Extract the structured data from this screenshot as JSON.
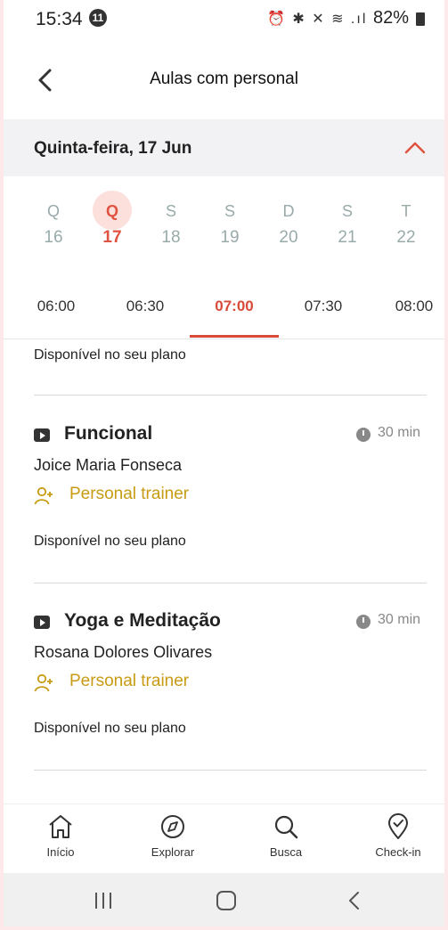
{
  "status_bar": {
    "time": "15:34",
    "notification_count": "11",
    "icons": "⏰ ✱ ✕ ≋ .ıl",
    "battery": "82%"
  },
  "header": {
    "title": "Aulas com personal",
    "back_icon": "chevron-left-icon"
  },
  "date_bar": {
    "label": "Quinta-feira, 17 Jun",
    "toggle_icon": "chevron-up-icon",
    "accent_color": "#e05340"
  },
  "week": [
    {
      "weekday": "Q",
      "day": "16"
    },
    {
      "weekday": "Q",
      "day": "17",
      "selected": true
    },
    {
      "weekday": "S",
      "day": "18"
    },
    {
      "weekday": "S",
      "day": "19"
    },
    {
      "weekday": "D",
      "day": "20"
    },
    {
      "weekday": "S",
      "day": "21"
    },
    {
      "weekday": "T",
      "day": "22"
    }
  ],
  "time_tabs": [
    "06:00",
    "06:30",
    "07:00",
    "07:30",
    "08:00"
  ],
  "active_time": "07:00",
  "list": {
    "top_availability": "Disponível no seu plano",
    "classes": [
      {
        "name": "Funcional",
        "duration": "30 min",
        "teacher": "Joice Maria Fonseca",
        "type": "Personal trainer",
        "availability": "Disponível no seu plano"
      },
      {
        "name": "Yoga e Meditação",
        "duration": "30 min",
        "teacher": "Rosana Dolores Olivares",
        "type": "Personal trainer",
        "availability": "Disponível no seu plano"
      }
    ]
  },
  "bottom_nav": [
    {
      "label": "Início",
      "icon": "home-icon"
    },
    {
      "label": "Explorar",
      "icon": "compass-icon"
    },
    {
      "label": "Busca",
      "icon": "search-icon"
    },
    {
      "label": "Check-in",
      "icon": "location-check-icon"
    }
  ],
  "colors": {
    "accent": "#d94b39",
    "personal_trainer": "#c89b13",
    "frame_background": "#fde8ea"
  }
}
